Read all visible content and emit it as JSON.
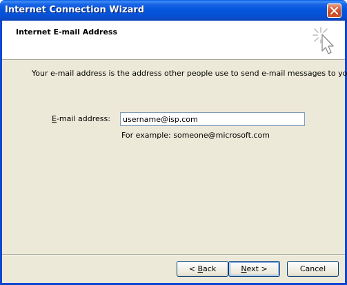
{
  "window": {
    "title": "Internet Connection Wizard"
  },
  "header": {
    "title": "Internet E-mail Address",
    "icon": "wizard-cursor-sparkle-icon"
  },
  "body": {
    "intro": "Your e-mail address is the address other people use to send e-mail messages to you.",
    "email_label_accel": "E",
    "email_label_rest": "-mail address:",
    "email_value": "username@isp.com",
    "example": "For example: someone@microsoft.com"
  },
  "buttons": {
    "back_prefix": "< ",
    "back_accel": "B",
    "back_rest": "ack",
    "next_accel": "N",
    "next_rest": "ext >",
    "cancel_label": "Cancel"
  },
  "colors": {
    "titlebar": "#0554dc",
    "dialog_bg": "#ece9d8",
    "close_button": "#d9623a"
  }
}
